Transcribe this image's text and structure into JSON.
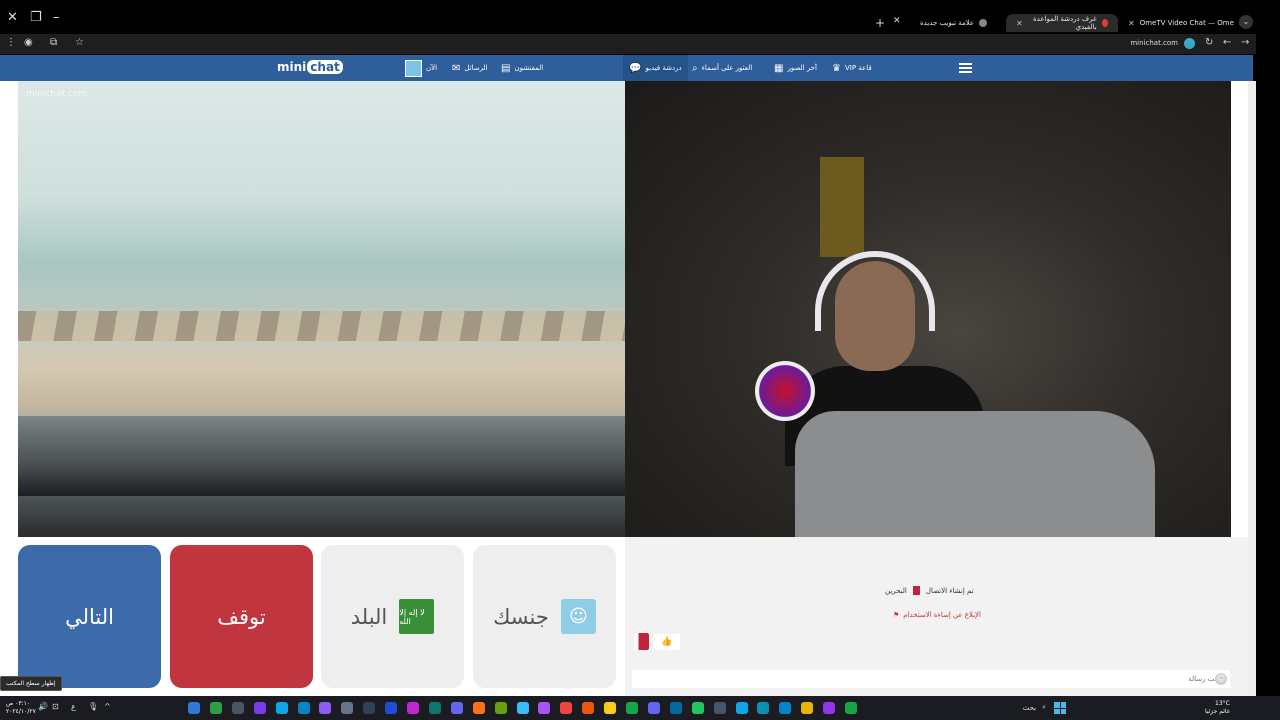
{
  "browser": {
    "tabs": [
      {
        "title": "OmeTV Video Chat — Ome",
        "active": false,
        "color": "#e53935"
      },
      {
        "title": "غرف دردشة المواعدة بالفيدي",
        "active": true,
        "color": "#e53935"
      },
      {
        "title": "علامة تبويب جديدة",
        "active": false,
        "color": "#888888"
      }
    ],
    "url": "minichat.com"
  },
  "site": {
    "logo_a": "mini",
    "logo_b": "chat",
    "nav": {
      "video_chat": "دردشة فيديو",
      "search_name": "العثور على أسماء",
      "last_photos": "آخر الصور",
      "vip": "VIP قاعة",
      "suspects": "المفتشون",
      "messages": "الرسائل",
      "now": "الآن"
    },
    "watermark": "minichat.com"
  },
  "controls": {
    "next": "التالي",
    "stop": "توقف",
    "country": "البلد",
    "gender": "جنسك",
    "flag_text": "لا إله إلا الله"
  },
  "chat": {
    "status": "تم إنشاء الاتصال",
    "country": "البحرين",
    "report": "الإبلاغ عن إساءة الاستخدام",
    "message_emoji": "👍",
    "input_placeholder": "اكتب رسالة"
  },
  "taskbar": {
    "tooltip": "إظهار سطح المكتب",
    "time": "٠٣:١٠ ص",
    "date": "٢٠٢٤/١٠/٢٧",
    "search": "بحث",
    "weather_temp": "13°C",
    "weather_desc": "غائم جزئيا",
    "lang": "ع",
    "colors": [
      "#2d7bd6",
      "#2ea043",
      "#4b5563",
      "#7c3aed",
      "#0ea5e9",
      "#0284c7",
      "#8b5cf6",
      "#64748b",
      "#334155",
      "#1d4ed8",
      "#c026d3",
      "#0f766e",
      "#6366f1",
      "#f97316",
      "#65a30d",
      "#38bdf8",
      "#a855f7",
      "#ef4444",
      "#ea580c",
      "#facc15",
      "#16a34a",
      "#6366f1",
      "#0369a1",
      "#22c55e",
      "#475569",
      "#0ea5e9",
      "#0891b2",
      "#0284c7",
      "#eab308",
      "#9333ea",
      "#16a34a"
    ]
  }
}
